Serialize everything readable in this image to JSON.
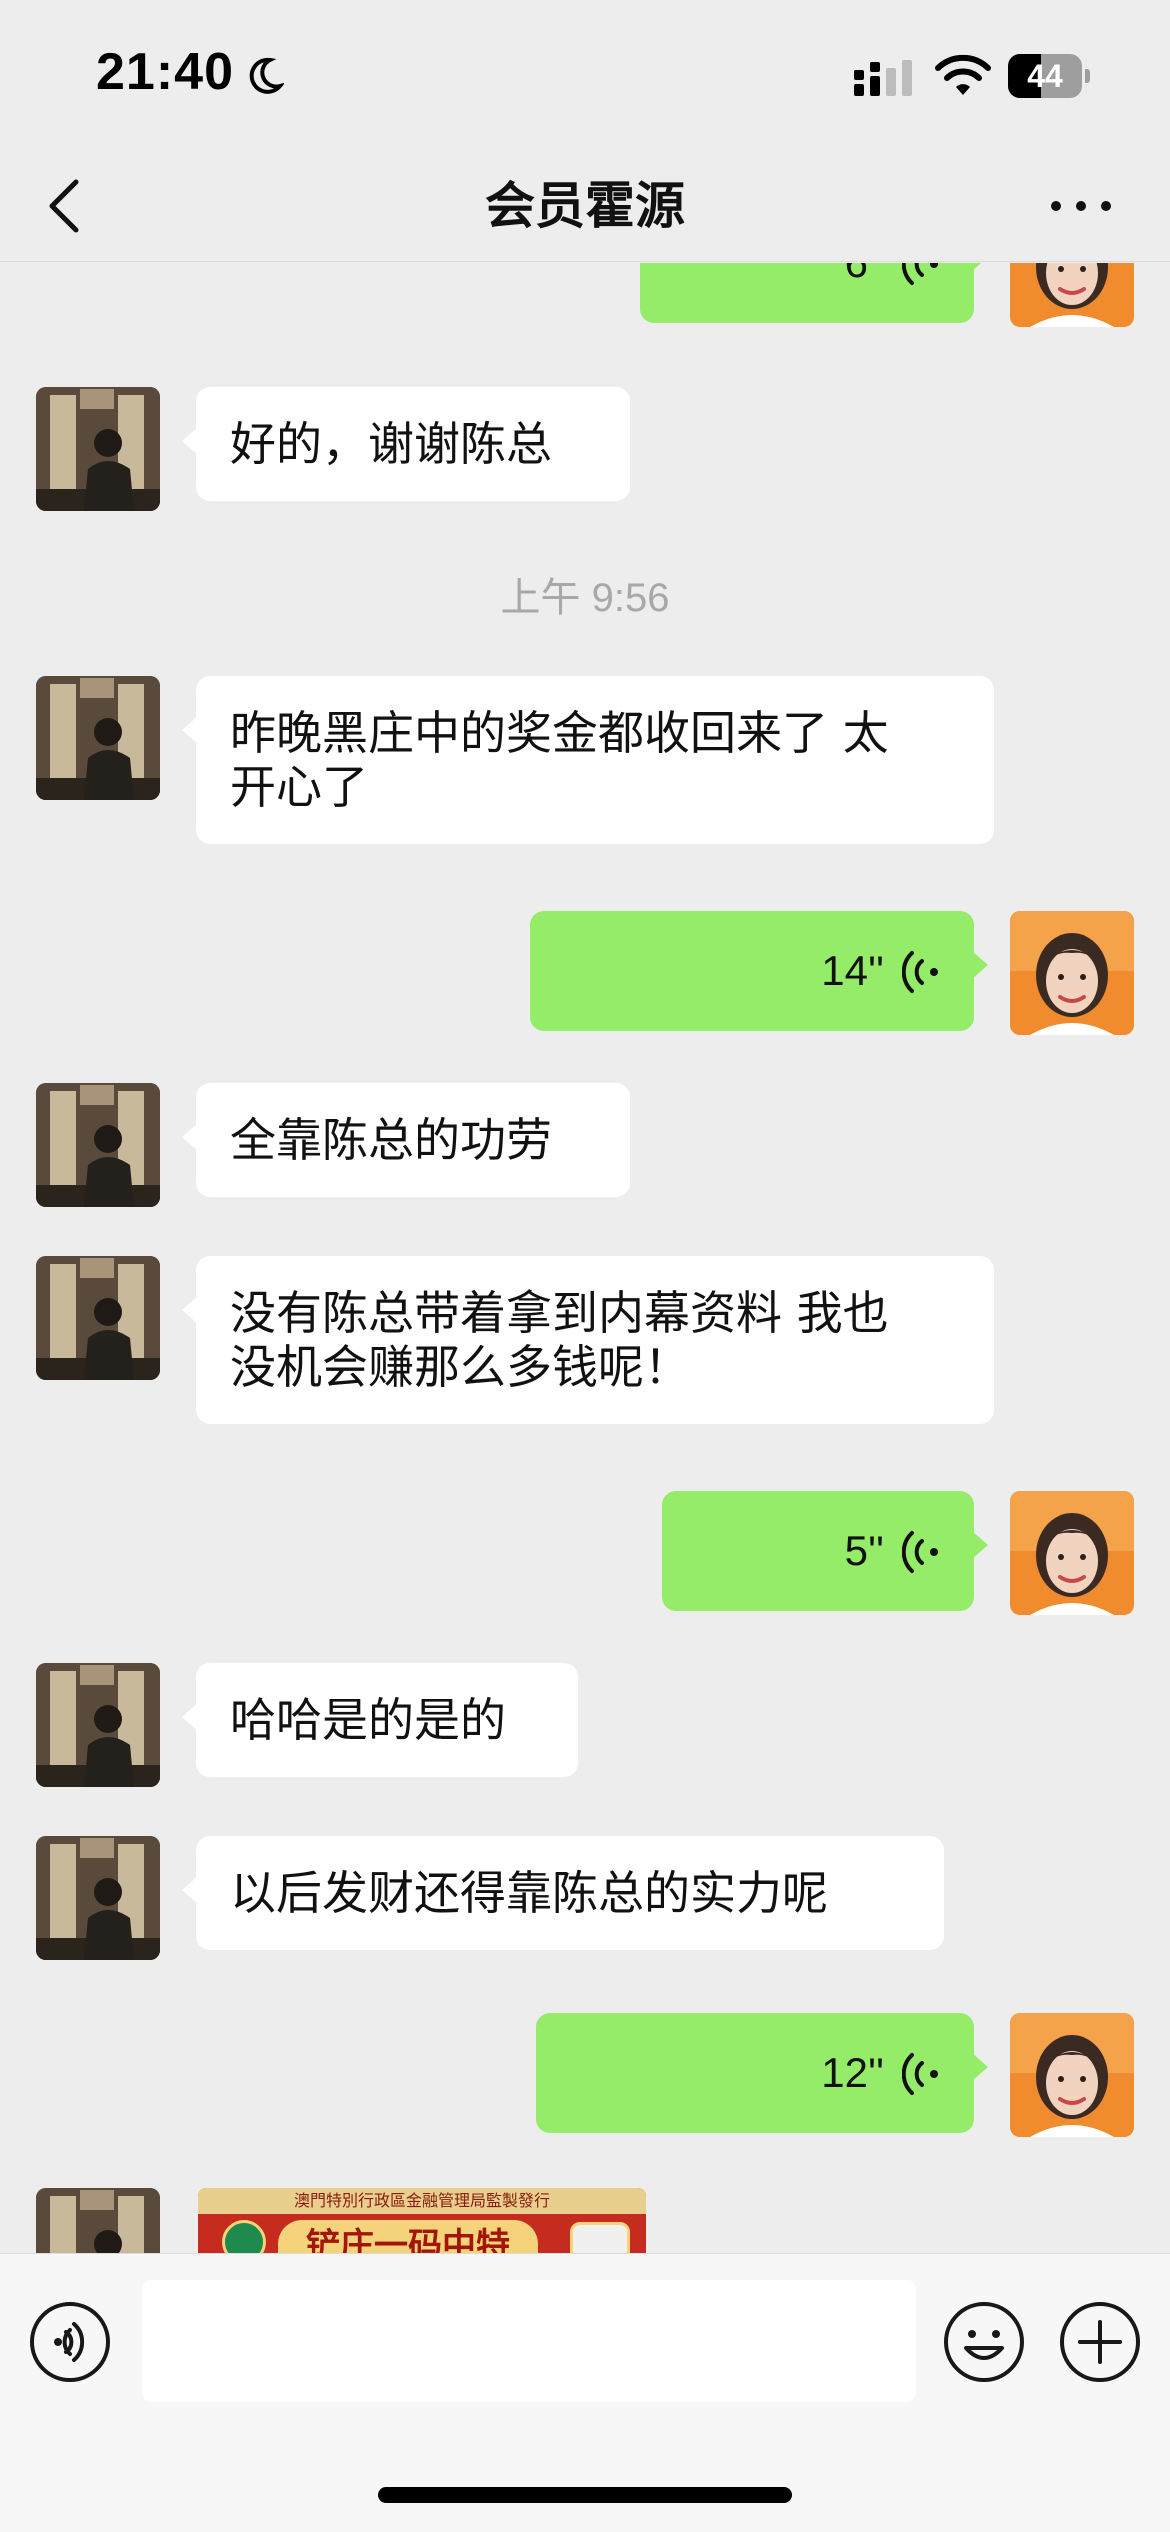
{
  "status_bar": {
    "time": "21:40",
    "battery_level": "44",
    "battery_fraction": 0.44,
    "icons": [
      "moon-icon",
      "cellular-signal-icon",
      "wifi-icon",
      "battery-icon"
    ]
  },
  "nav": {
    "title": "会员霍源",
    "back_icon": "chevron-left-icon",
    "more_icon": "more-dots-icon"
  },
  "messages": [
    {
      "side": "out",
      "type": "voice",
      "duration": "6''"
    },
    {
      "side": "in",
      "type": "text",
      "text": "好的，谢谢陈总"
    },
    {
      "type": "timestamp",
      "text": "上午 9:56"
    },
    {
      "side": "in",
      "type": "text",
      "lines": [
        "昨晚黑庄中的奖金都收回来了 太",
        "开心了"
      ]
    },
    {
      "side": "out",
      "type": "voice",
      "duration": "14''"
    },
    {
      "side": "in",
      "type": "text",
      "text": "全靠陈总的功劳"
    },
    {
      "side": "in",
      "type": "text",
      "lines": [
        "没有陈总带着拿到内幕资料 我也",
        "没机会赚那么多钱呢！"
      ]
    },
    {
      "side": "out",
      "type": "voice",
      "duration": "5''"
    },
    {
      "side": "in",
      "type": "text",
      "text": "哈哈是的是的"
    },
    {
      "side": "in",
      "type": "text",
      "text": "以后发财还得靠陈总的实力呢"
    },
    {
      "side": "out",
      "type": "voice",
      "duration": "12''"
    },
    {
      "side": "in",
      "type": "image",
      "caption_top": "澳門特別行政區金融管理局監製發行",
      "caption_main": "铲庄一码中特"
    }
  ],
  "input_bar": {
    "voice_icon": "voice-mode-icon",
    "placeholder": "",
    "emoji_icon": "emoji-icon",
    "plus_icon": "plus-icon"
  },
  "colors": {
    "background": "#ededed",
    "outgoing_bubble": "#95ec69",
    "incoming_bubble": "#ffffff",
    "timestamp_text": "#a8a8a8"
  }
}
